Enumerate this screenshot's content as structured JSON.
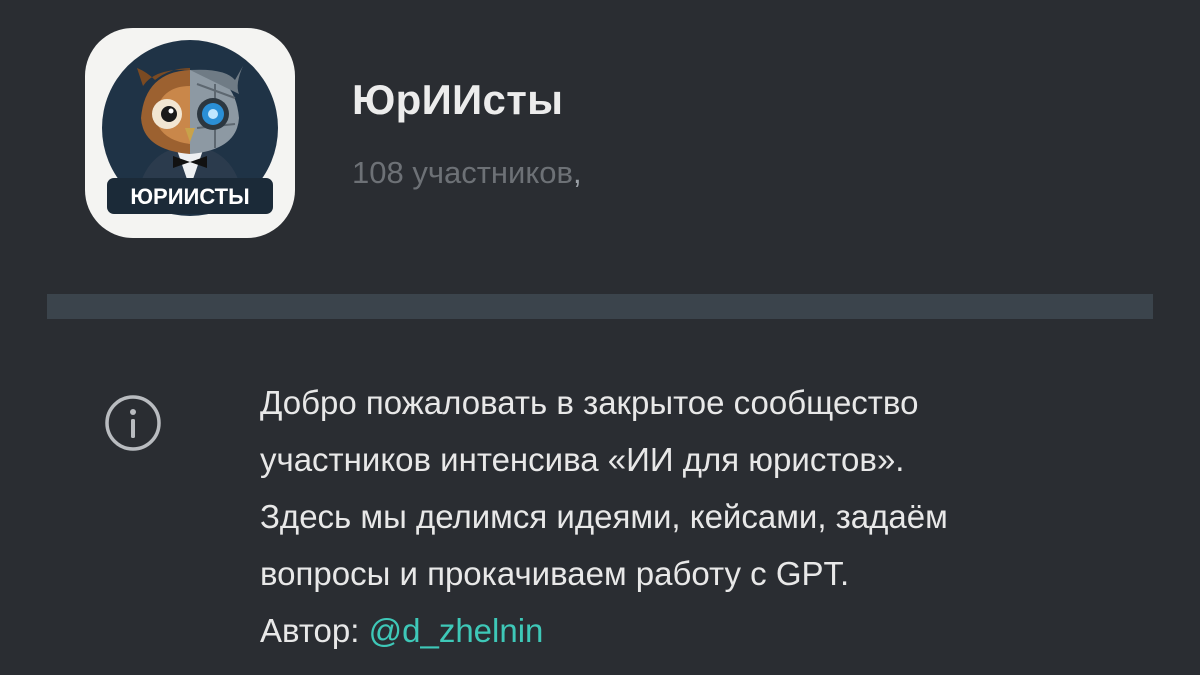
{
  "header": {
    "title": "ЮрИИсты",
    "members": "108 участников",
    "members_cursor": ",",
    "avatar": {
      "badge_text": "ЮРИИСТЫ",
      "icon": "owl-robot-logo-icon"
    }
  },
  "info": {
    "icon": "info-circle-icon",
    "description_lines": [
      "Добро пожаловать в закрытое сообщество",
      "участников интенсива «ИИ для юристов».",
      "Здесь мы делимся идеями, кейсами, задаём",
      "вопросы и прокачиваем работу с GPT."
    ],
    "author_label": "Автор: ",
    "author_handle": "@d_zhelnin"
  },
  "colors": {
    "background": "#2a2d32",
    "divider": "#3b444c",
    "link": "#3ec8b8",
    "muted_text": "#6d7176",
    "primary_text": "#ececec"
  }
}
